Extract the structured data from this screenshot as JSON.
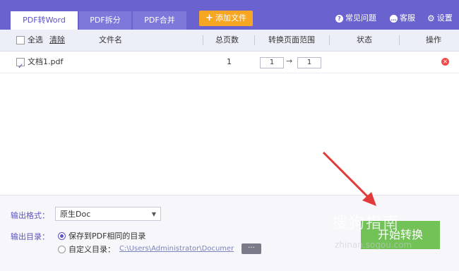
{
  "tabs": [
    {
      "label": "PDF转Word",
      "active": true
    },
    {
      "label": "PDF拆分",
      "active": false
    },
    {
      "label": "PDF合并",
      "active": false
    }
  ],
  "add_file_label": "添加文件",
  "top_links": {
    "faq": "常见问题",
    "service": "客服",
    "settings": "设置"
  },
  "header": {
    "select_all": "全选",
    "clear": "清除",
    "filename": "文件名",
    "total_pages": "总页数",
    "page_range": "转换页面范围",
    "status": "状态",
    "actions": "操作"
  },
  "files": [
    {
      "name": "文档1.pdf",
      "pages": "1",
      "range_from": "1",
      "range_to": "1",
      "status": "",
      "checked": true
    }
  ],
  "output": {
    "format_label": "输出格式：",
    "format_value": "原生Doc",
    "dir_label": "输出目录：",
    "option_same": "保存到PDF相同的目录",
    "option_custom": "自定义目录：",
    "custom_path": "C:\\Users\\Administrator\\Documer",
    "more_label": "···"
  },
  "start_label": "开始转换",
  "watermark": {
    "text": "搜狗指南",
    "url": "zhinan.sogou.com"
  },
  "colors": {
    "accent": "#6a63cf",
    "orange": "#f5a623",
    "green": "#72c257",
    "delete": "#ee4d4d"
  }
}
